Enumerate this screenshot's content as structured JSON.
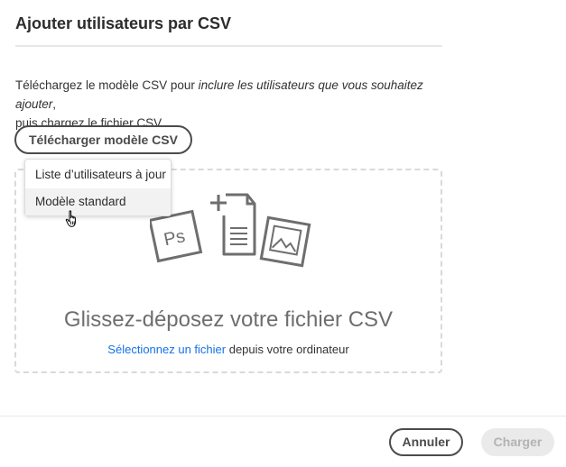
{
  "dialog": {
    "title": "Ajouter utilisateurs par CSV",
    "description_part1": "Téléchargez le modèle CSV pour ",
    "description_emphasis": "inclure les utilisateurs que vous souhaitez ajouter",
    "description_part2": ",",
    "description_line2": "puis chargez le fichier CSV."
  },
  "download_button": {
    "label": "Télécharger modèle CSV"
  },
  "dropdown_menu": {
    "items": [
      {
        "label": "Liste d’utilisateurs à jour",
        "hovered": false
      },
      {
        "label": "Modèle standard",
        "hovered": true
      }
    ]
  },
  "dropzone": {
    "title": "Glissez-déposez votre fichier CSV",
    "link_text": "Sélectionnez un fichier",
    "subtitle_rest": " depuis votre ordinateur",
    "illustration": {
      "icons": [
        "photoshop-file-icon",
        "add-document-icon",
        "image-file-icon"
      ],
      "ps_text": "Ps"
    }
  },
  "footer": {
    "cancel_label": "Annuler",
    "submit_label": "Charger"
  },
  "colors": {
    "link": "#1473e6",
    "button_border": "#4b4b4b",
    "disabled_bg": "#eaeaea",
    "disabled_text": "#b3b3b3",
    "dropzone_border": "#d9d9d9"
  }
}
